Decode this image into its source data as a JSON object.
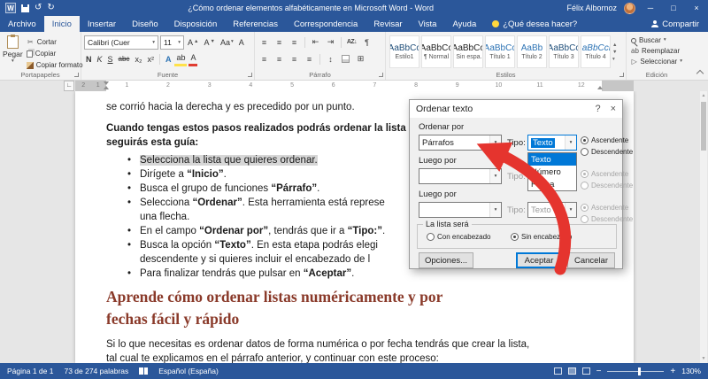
{
  "titlebar": {
    "title": "¿Cómo ordenar elementos alfabéticamente en Microsoft Word - Word",
    "user": "Félix Albornoz"
  },
  "icons": {
    "logo": "W",
    "undo": "↺",
    "redo": "↻",
    "minimize": "─",
    "maximize": "□",
    "close": "×",
    "caret": "▾",
    "help": "?",
    "dialog_close": "×",
    "pilcrow": "¶",
    "scissors": "✂",
    "sort": "AZ↓",
    "lines": "≡",
    "updown": "↕",
    "borders": "⊞",
    "select": "▷",
    "up": "▲",
    "down": "▼",
    "outdent": "⇤",
    "indent": "⇥",
    "minus": "−",
    "plus": "+",
    "angle": "∟"
  },
  "tabs": {
    "items": [
      "Archivo",
      "Inicio",
      "Insertar",
      "Diseño",
      "Disposición",
      "Referencias",
      "Correspondencia",
      "Revisar",
      "Vista",
      "Ayuda"
    ],
    "selected": "Inicio",
    "assist": "¿Qué desea hacer?",
    "share": "Compartir"
  },
  "ribbon": {
    "clipboard": {
      "group": "Portapapeles",
      "paste": "Pegar",
      "cut": "Cortar",
      "copy": "Copiar",
      "format_painter": "Copiar formato"
    },
    "font": {
      "group": "Fuente",
      "family": "Calibri (Cuer",
      "size": "11",
      "bold": "N",
      "italic": "K",
      "underline": "S",
      "strike": "abc",
      "subscript": "x₂",
      "superscript": "x²",
      "effects": "A",
      "highlight": "ab",
      "color": "A",
      "grow": "A",
      "shrink": "A",
      "case": "Aa",
      "clear": "A"
    },
    "paragraph": {
      "group": "Párrafo"
    },
    "styles": {
      "group": "Estilos",
      "items": [
        {
          "preview": "AaBbCc",
          "name": "Estilo1",
          "color": "#1f4e79",
          "italic": false
        },
        {
          "preview": "AaBbCc",
          "name": "¶ Normal",
          "color": "#222222",
          "italic": false
        },
        {
          "preview": "AaBbCc",
          "name": "¶ Sin espa...",
          "color": "#222222",
          "italic": false
        },
        {
          "preview": "AaBbCc",
          "name": "Título 1",
          "color": "#2e74b5",
          "italic": false
        },
        {
          "preview": "AaBb",
          "name": "Título 2",
          "color": "#2e74b5",
          "italic": false
        },
        {
          "preview": "AaBbCc",
          "name": "Título 3",
          "color": "#1f4e79",
          "italic": false
        },
        {
          "preview": "AaBbCcD",
          "name": "Título 4",
          "color": "#2e74b5",
          "italic": true
        }
      ]
    },
    "editing": {
      "group": "Edición",
      "find": "Buscar",
      "replace": "Reemplazar",
      "select": "Seleccionar"
    }
  },
  "ruler": {
    "left_numbers": [
      "2",
      "1"
    ],
    "numbers": [
      "1",
      "2",
      "3",
      "4",
      "5",
      "6",
      "7",
      "8",
      "9",
      "10",
      "11",
      "12"
    ]
  },
  "document": {
    "para1": "se corrió hacia la derecha y es precedido por un punto.",
    "para2": {
      "l1": "Cuando tengas estos pasos realizados podrás ordenar la lista",
      "l2": "seguirás esta guía:"
    },
    "bullets": [
      {
        "highlight": true,
        "lines": [
          [
            {
              "t": "Selecciona la lista que quieres ordenar."
            }
          ]
        ]
      },
      {
        "lines": [
          [
            {
              "t": "Dirígete a "
            },
            {
              "t": "“Inicio”",
              "b": true
            },
            {
              "t": "."
            }
          ]
        ]
      },
      {
        "lines": [
          [
            {
              "t": "Busca el grupo de funciones "
            },
            {
              "t": "“Párrafo”",
              "b": true
            },
            {
              "t": "."
            }
          ]
        ]
      },
      {
        "lines": [
          [
            {
              "t": "Selecciona "
            },
            {
              "t": "“Ordenar”",
              "b": true
            },
            {
              "t": ". Esta herramienta está represe"
            }
          ],
          [
            {
              "t": "una flecha."
            }
          ]
        ]
      },
      {
        "lines": [
          [
            {
              "t": "En el campo "
            },
            {
              "t": "“Ordenar por”",
              "b": true
            },
            {
              "t": ", tendrás que ir a "
            },
            {
              "t": "“Tipo:”",
              "b": true
            },
            {
              "t": "."
            }
          ]
        ]
      },
      {
        "lines": [
          [
            {
              "t": "Busca la opción "
            },
            {
              "t": "“Texto”",
              "b": true
            },
            {
              "t": ". En esta etapa podrás elegi"
            }
          ],
          [
            {
              "t": "descendente y si quieres incluir el encabezado de l"
            }
          ]
        ]
      },
      {
        "lines": [
          [
            {
              "t": "Para finalizar tendrás que pulsar en "
            },
            {
              "t": "“Aceptar”",
              "b": true
            },
            {
              "t": "."
            }
          ]
        ]
      }
    ],
    "heading": {
      "l1": "Aprende cómo ordenar listas numéricamente y por",
      "l2": "fechas fácil y rápido"
    },
    "para3": {
      "l1": "Si lo que necesitas es ordenar datos de forma numérica o por fecha tendrás que crear la lista,",
      "l2": "tal cual te explicamos en el párrafo anterior, y continuar con este proceso:"
    }
  },
  "dialog": {
    "title": "Ordenar texto",
    "labels": {
      "sort_by": "Ordenar por",
      "then_by": "Luego por",
      "type": "Tipo:",
      "asc": "Ascendente",
      "desc": "Descendente",
      "list_is": "La lista será",
      "with_header": "Con encabezado",
      "without_header": "Sin encabezado"
    },
    "sort_field": "Párrafos",
    "type_value": "Texto",
    "type_options": [
      "Texto",
      "Número",
      "Fecha"
    ],
    "buttons": {
      "options": "Opciones...",
      "ok": "Aceptar",
      "cancel": "Cancelar"
    }
  },
  "statusbar": {
    "page": "Página 1 de 1",
    "words": "73 de 274 palabras",
    "language": "Español (España)",
    "zoom": "130%"
  },
  "colors": {
    "accent": "#2b579a",
    "selection": "#0078d7",
    "arrow": "#e5342e",
    "heading": "#8a3a2a",
    "text_highlight": "#d6d6d6"
  }
}
